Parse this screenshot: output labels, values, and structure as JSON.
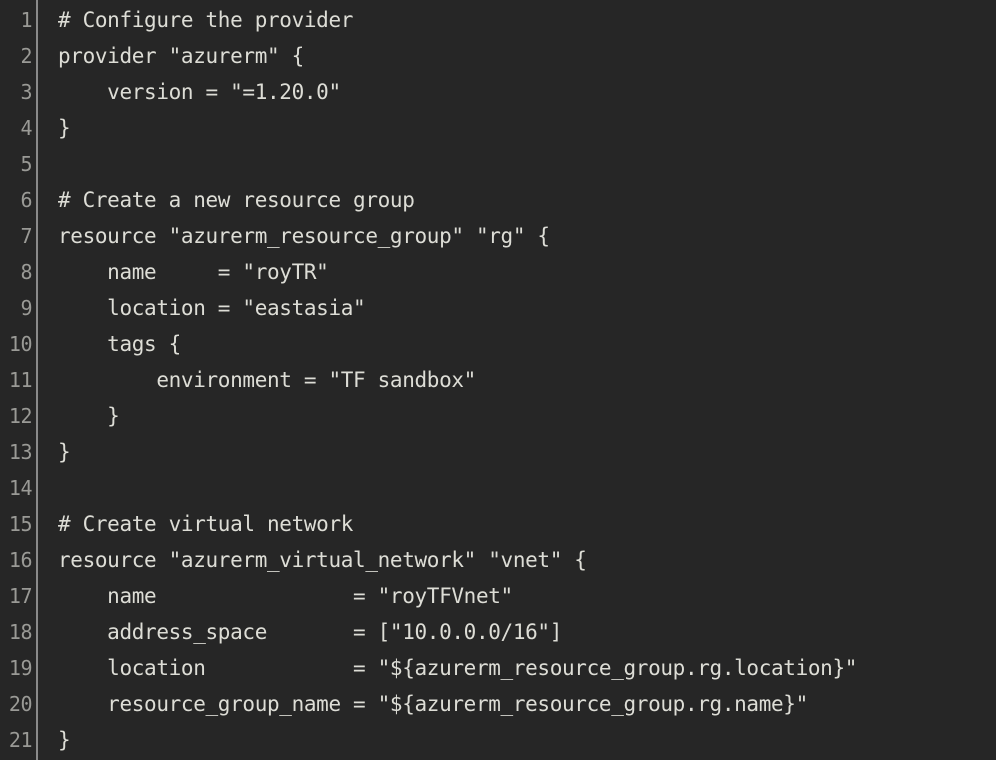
{
  "editor": {
    "theme": "dark",
    "language": "terraform-hcl",
    "background_color": "#262626",
    "text_color": "#ddddd6",
    "line_number_color": "#9a9a96",
    "gutter_rule_color": "#8a8a8a",
    "first_visible_line": 1,
    "last_visible_line": 21,
    "total_visible_lines": 21
  },
  "lines": [
    {
      "number": "1",
      "text": "# Configure the provider"
    },
    {
      "number": "2",
      "text": "provider \"azurerm\" {"
    },
    {
      "number": "3",
      "text": "    version = \"=1.20.0\""
    },
    {
      "number": "4",
      "text": "}"
    },
    {
      "number": "5",
      "text": ""
    },
    {
      "number": "6",
      "text": "# Create a new resource group"
    },
    {
      "number": "7",
      "text": "resource \"azurerm_resource_group\" \"rg\" {"
    },
    {
      "number": "8",
      "text": "    name     = \"royTR\""
    },
    {
      "number": "9",
      "text": "    location = \"eastasia\""
    },
    {
      "number": "10",
      "text": "    tags {"
    },
    {
      "number": "11",
      "text": "        environment = \"TF sandbox\""
    },
    {
      "number": "12",
      "text": "    }"
    },
    {
      "number": "13",
      "text": "}"
    },
    {
      "number": "14",
      "text": ""
    },
    {
      "number": "15",
      "text": "# Create virtual network"
    },
    {
      "number": "16",
      "text": "resource \"azurerm_virtual_network\" \"vnet\" {"
    },
    {
      "number": "17",
      "text": "    name                = \"royTFVnet\""
    },
    {
      "number": "18",
      "text": "    address_space       = [\"10.0.0.0/16\"]"
    },
    {
      "number": "19",
      "text": "    location            = \"${azurerm_resource_group.rg.location}\""
    },
    {
      "number": "20",
      "text": "    resource_group_name = \"${azurerm_resource_group.rg.name}\""
    },
    {
      "number": "21",
      "text": "}"
    }
  ]
}
